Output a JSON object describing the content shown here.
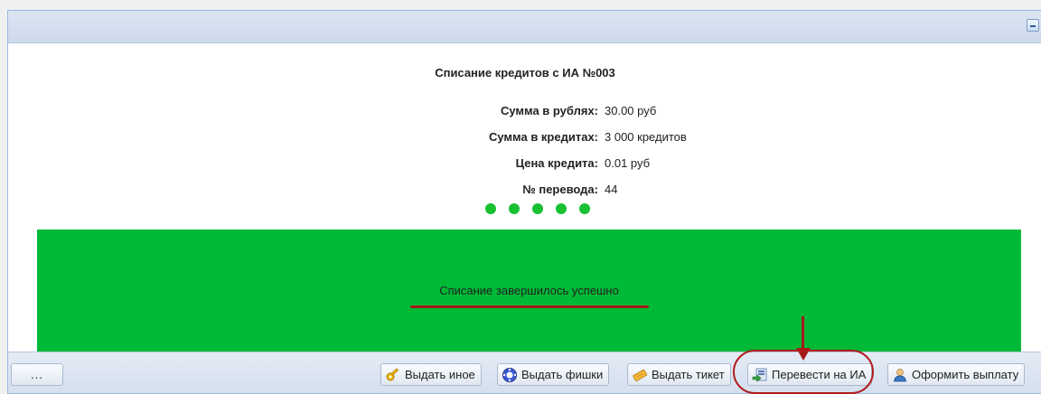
{
  "window": {
    "collapse_icon": "collapse-icon"
  },
  "details": {
    "title": "Списание кредитов с ИА №003",
    "rows": [
      {
        "label": "Сумма в рублях:",
        "value": "30.00 руб"
      },
      {
        "label": "Сумма в кредитах:",
        "value": "3 000 кредитов"
      },
      {
        "label": "Цена кредита:",
        "value": "0.01 руб"
      },
      {
        "label": "№ перевода:",
        "value": "44"
      }
    ],
    "progress_dots": {
      "total": 5,
      "filled": 5
    }
  },
  "status": {
    "message": "Списание завершилось успешно",
    "color": "#00b936"
  },
  "toolbar": {
    "more_label": "...",
    "buttons": [
      {
        "label": "Выдать иное",
        "icon": "key-icon"
      },
      {
        "label": "Выдать фишки",
        "icon": "chips-icon"
      },
      {
        "label": "Выдать тикет",
        "icon": "ticket-icon"
      },
      {
        "label": "Перевести на ИА",
        "icon": "transfer-icon"
      },
      {
        "label": "Оформить выплату",
        "icon": "user-payout-icon"
      }
    ]
  },
  "annotations": {
    "highlight_color": "#a51a1a"
  }
}
